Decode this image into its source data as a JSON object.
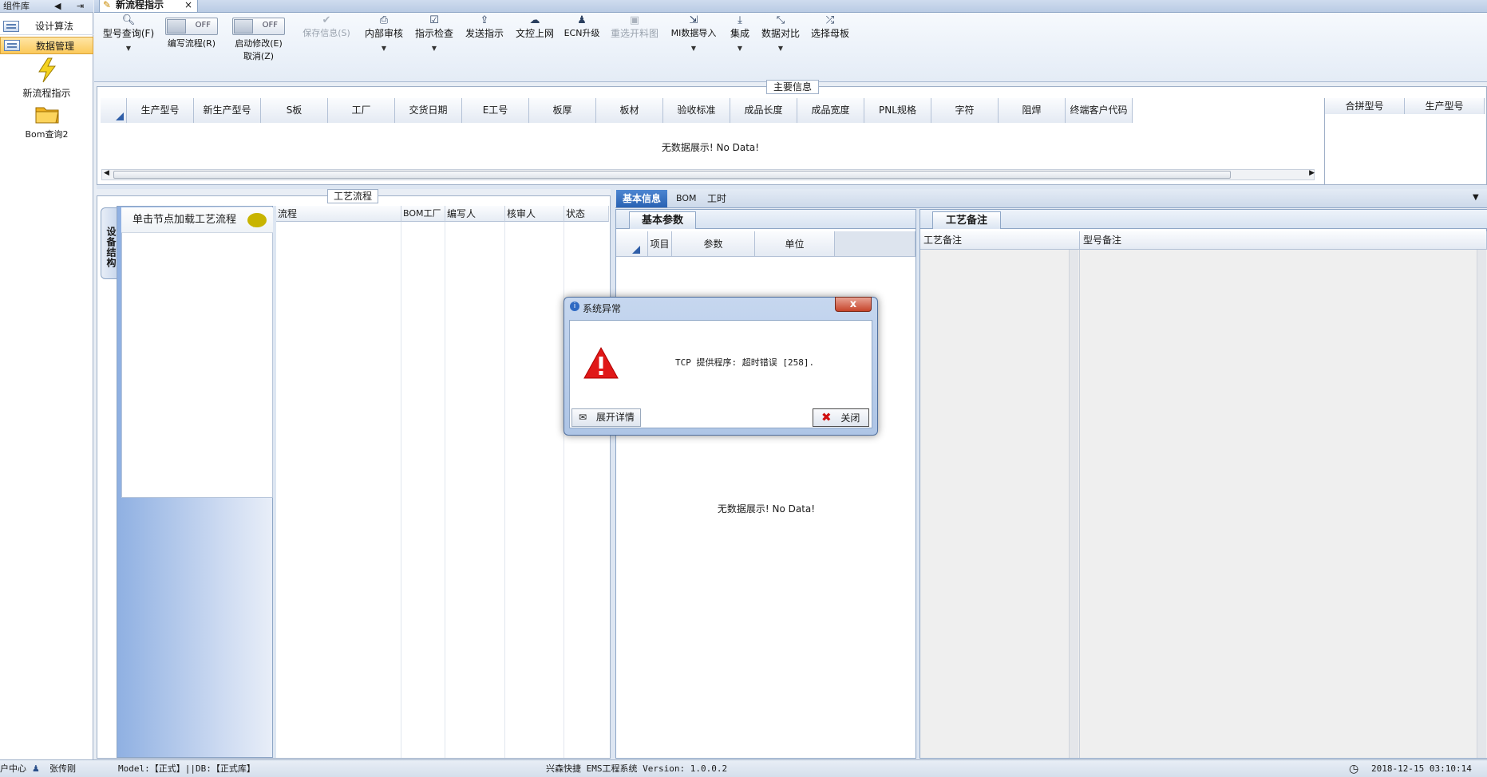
{
  "sidebar": {
    "header": "组件库",
    "items": [
      {
        "label": "设计算法",
        "icon": "list-panel-icon"
      },
      {
        "label": "数据管理",
        "icon": "list-panel-icon",
        "active": true
      }
    ],
    "tiles": [
      {
        "label": "新流程指示",
        "icon": "lightning-icon"
      },
      {
        "label": "Bom查询2",
        "icon": "folder-icon"
      }
    ]
  },
  "doc_tab": {
    "label": "新流程指示",
    "close": "×"
  },
  "toolbar": {
    "model_query": "型号查询(F)",
    "edit_flow": "编写流程(R)",
    "edit_flow_toggle": "OFF",
    "start_modify": "启动修改(E)",
    "start_modify_toggle": "OFF",
    "cancel": "取消(Z)",
    "save_info": "保存信息(S)",
    "internal_audit": "内部审核",
    "instruction_check": "指示检查",
    "send_instruction": "发送指示",
    "upload_doc": "文控上网",
    "ecn_upgrade": "ECN升级",
    "reselect_material": "重选开料图",
    "mi_import": "MI数据导入",
    "integrate": "集成",
    "data_compare": "数据对比",
    "select_mother_board": "选择母板"
  },
  "main_info": {
    "legend": "主要信息",
    "columns": [
      "生产型号",
      "新生产型号",
      "S板",
      "工厂",
      "交货日期",
      "E工号",
      "板厚",
      "板材",
      "验收标准",
      "成品长度",
      "成品宽度",
      "PNL规格",
      "字符",
      "阻焊",
      "终端客户代码"
    ],
    "side_columns": [
      "合拼型号",
      "生产型号"
    ],
    "no_data": "无数据展示! No Data!"
  },
  "process": {
    "legend": "工艺流程",
    "vertical_tab": "设备结构",
    "tree_hint": "单击节点加载工艺流程",
    "columns": [
      "流程",
      "BOM工厂",
      "编写人",
      "核审人",
      "状态"
    ]
  },
  "right_tabs": [
    "基本信息",
    "BOM",
    "工时"
  ],
  "basic_params": {
    "tab": "基本参数",
    "columns": [
      "项目",
      "参数",
      "单位"
    ],
    "no_data": "无数据展示! No Data!"
  },
  "process_notes": {
    "tab": "工艺备注",
    "columns": [
      "工艺备注",
      "型号备注"
    ]
  },
  "status_bar": {
    "center": "户中心",
    "user": "张传刚",
    "model": "Model:【正式】||DB:【正式库】",
    "system": "兴森快捷 EMS工程系统 Version: 1.0.0.2",
    "datetime": "2018-12-15 03:10:14"
  },
  "dialog": {
    "title": "系统异常",
    "message": "TCP 提供程序: 超时错误 [258].",
    "expand_label": "展开详情",
    "close_label": "关闭",
    "title_close": "x"
  },
  "colors": {
    "accent": "#2962b3",
    "active_sidebar": "#fbc95a",
    "error": "#e02020"
  }
}
